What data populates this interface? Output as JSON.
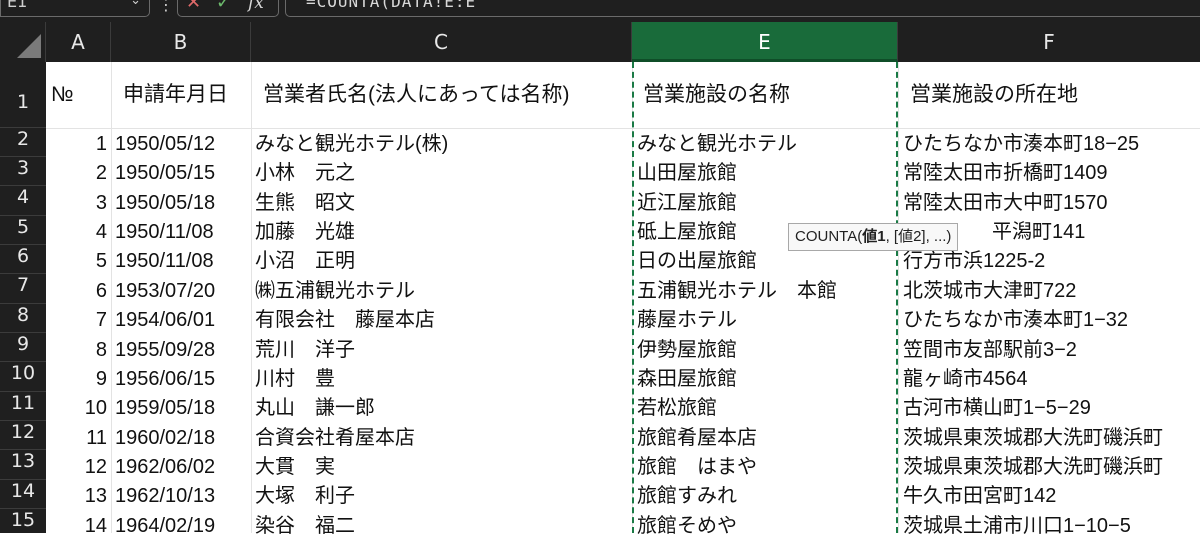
{
  "formula_bar": {
    "name_box": "E1",
    "dots": "⋮",
    "cancel_icon": "✕",
    "enter_icon": "✓",
    "fx_label": "fx",
    "formula": "=COUNTA(DATA!E:E"
  },
  "columns": [
    "A",
    "B",
    "C",
    "E",
    "F"
  ],
  "selected_column": "E",
  "row_numbers": [
    "1",
    "2",
    "3",
    "4",
    "5",
    "6",
    "7",
    "8",
    "9",
    "10",
    "11",
    "12",
    "13",
    "14",
    "15"
  ],
  "header_row": {
    "A": "№",
    "B": "申請年月日",
    "C": "営業者氏名(法人にあっては名称)",
    "E": "営業施設の名称",
    "F": "営業施設の所在地"
  },
  "rows": [
    {
      "A": "1",
      "B": "1950/05/12",
      "C": "みなと観光ホテル(株)",
      "E": "みなと観光ホテル",
      "F": "ひたちなか市湊本町18−25"
    },
    {
      "A": "2",
      "B": "1950/05/15",
      "C": "小林　元之",
      "E": "山田屋旅館",
      "F": "常陸太田市折橋町1409"
    },
    {
      "A": "3",
      "B": "1950/05/18",
      "C": "生熊　昭文",
      "E": "近江屋旅館",
      "F": "常陸太田市大中町1570"
    },
    {
      "A": "4",
      "B": "1950/11/08",
      "C": "加藤　光雄",
      "E": "砥上屋旅館",
      "F": "平潟町141"
    },
    {
      "A": "5",
      "B": "1950/11/08",
      "C": "小沼　正明",
      "E": "日の出屋旅館",
      "F": "行方市浜1225-2"
    },
    {
      "A": "6",
      "B": "1953/07/20",
      "C": "㈱五浦観光ホテル",
      "E": "五浦観光ホテル　本館",
      "F": "北茨城市大津町722"
    },
    {
      "A": "7",
      "B": "1954/06/01",
      "C": "有限会社　藤屋本店",
      "E": "藤屋ホテル",
      "F": "ひたちなか市湊本町1−32"
    },
    {
      "A": "8",
      "B": "1955/09/28",
      "C": "荒川　洋子",
      "E": "伊勢屋旅館",
      "F": "笠間市友部駅前3−2"
    },
    {
      "A": "9",
      "B": "1956/06/15",
      "C": "川村　豊",
      "E": "森田屋旅館",
      "F": "龍ヶ崎市4564"
    },
    {
      "A": "10",
      "B": "1959/05/18",
      "C": "丸山　謙一郎",
      "E": "若松旅館",
      "F": "古河市横山町1−5−29"
    },
    {
      "A": "11",
      "B": "1960/02/18",
      "C": "合資会社肴屋本店",
      "E": "旅館肴屋本店",
      "F": "茨城県東茨城郡大洗町磯浜町"
    },
    {
      "A": "12",
      "B": "1962/06/02",
      "C": "大貫　実",
      "E": "旅館　はまや",
      "F": "茨城県東茨城郡大洗町磯浜町"
    },
    {
      "A": "13",
      "B": "1962/10/13",
      "C": "大塚　利子",
      "E": "旅館すみれ",
      "F": "牛久市田宮町142"
    },
    {
      "A": "14",
      "B": "1964/02/19",
      "C": "染谷　福二",
      "E": "旅館そめや",
      "F": "茨城県土浦市川口1−10−5"
    }
  ],
  "tooltip": {
    "fn": "COUNTA(",
    "arg1": "値1",
    "rest": ", [値2], ...)"
  },
  "colors": {
    "header_bg": "#1f1f1f",
    "selected_col": "#196b3a",
    "gridline": "#e3e3e3"
  }
}
